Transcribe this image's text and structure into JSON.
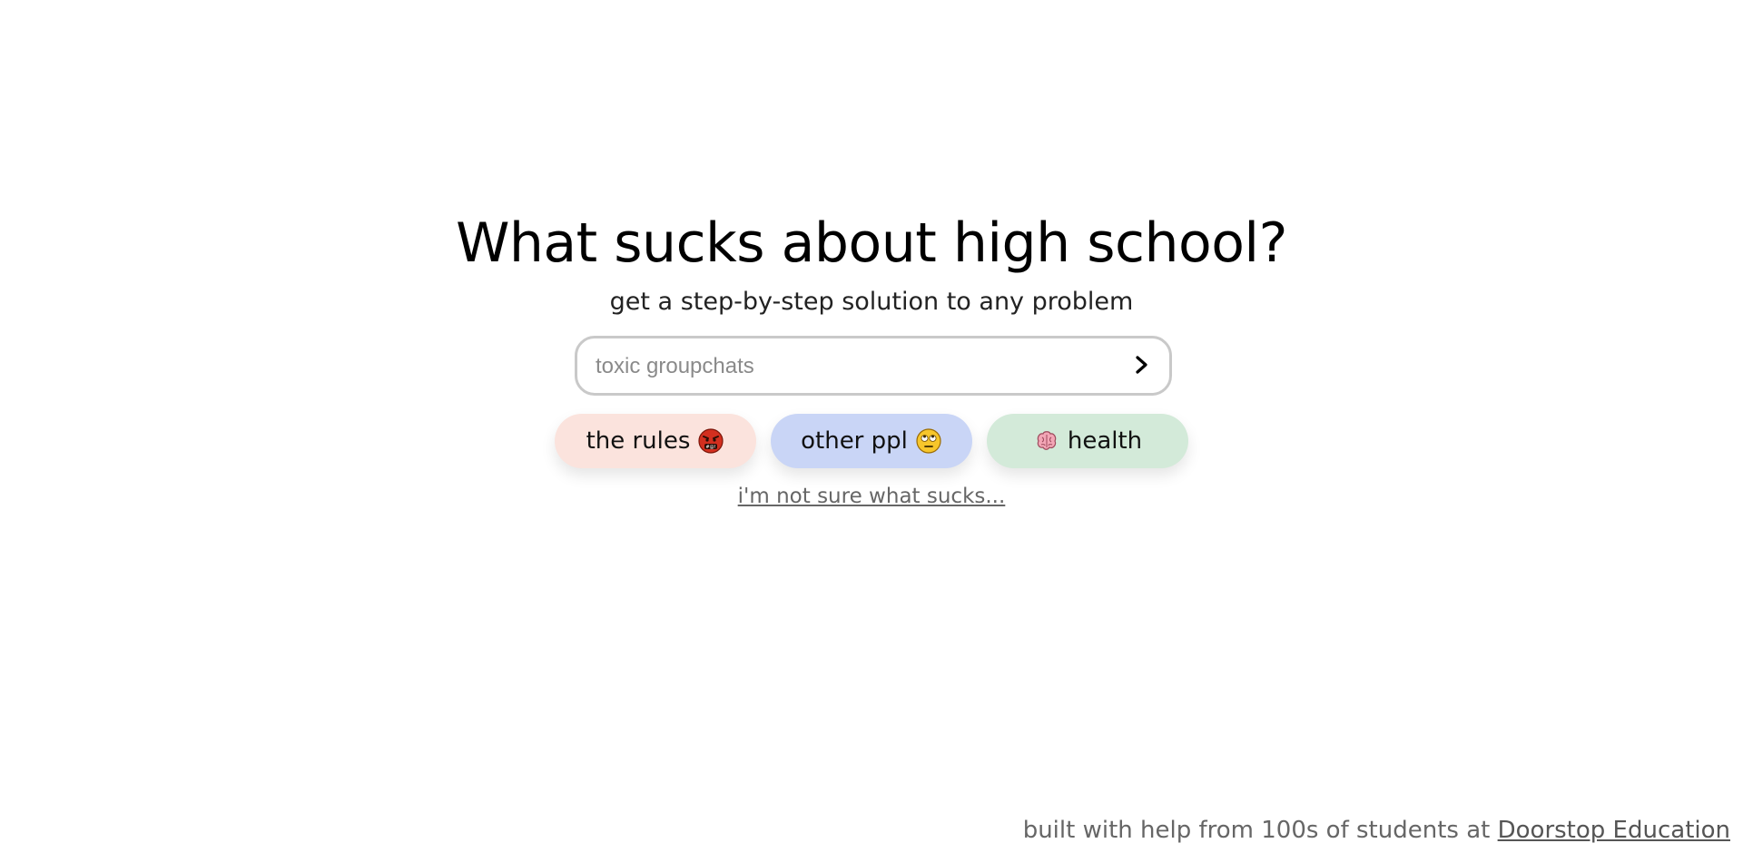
{
  "hero": {
    "headline": "What sucks about high school?",
    "subtitle": "get a step-by-step solution to any problem"
  },
  "search": {
    "placeholder": "toxic groupchats",
    "value": "",
    "submit_icon": "chevron-right-icon"
  },
  "chips": [
    {
      "label": "the rules",
      "emoji": "angry-face-with-symbols",
      "color": "#fbe3dd"
    },
    {
      "label": "other ppl",
      "emoji": "face-with-rolling-eyes",
      "color": "#c9d5f6"
    },
    {
      "label": "health",
      "emoji": "brain",
      "color": "#d3ead9"
    }
  ],
  "unsure_link": "i'm not sure what sucks...",
  "footer": {
    "text": "built with help from 100s of students at",
    "link": "Doorstop Education"
  }
}
